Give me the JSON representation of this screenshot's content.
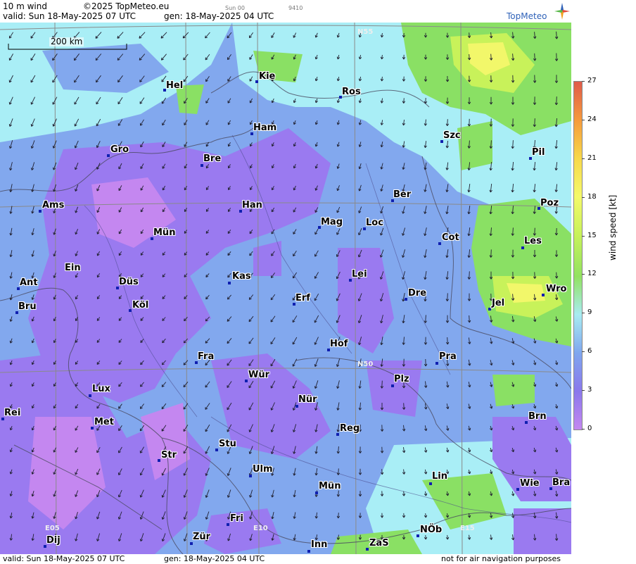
{
  "header": {
    "product": "10 m wind",
    "copyright": "©2025 TopMeteo.eu",
    "valid": "valid:  Sun  18-May-2025  07 UTC",
    "gen": "gen: 18-May-2025 04 UTC",
    "small_run": "Sun 00",
    "small_code": "9410",
    "logo_text": "TopMeteo"
  },
  "scale_bar": {
    "label": "200 km"
  },
  "grid_labels": [
    "N55",
    "N50",
    "E05",
    "E10",
    "E15"
  ],
  "cities": [
    {
      "name": "Kie"
    },
    {
      "name": "Hel"
    },
    {
      "name": "Ros"
    },
    {
      "name": "Ham"
    },
    {
      "name": "Szc"
    },
    {
      "name": "Gro"
    },
    {
      "name": "Bre"
    },
    {
      "name": "Pil"
    },
    {
      "name": "Ber"
    },
    {
      "name": "Ams"
    },
    {
      "name": "Han"
    },
    {
      "name": "Poz"
    },
    {
      "name": "Mag"
    },
    {
      "name": "Loc"
    },
    {
      "name": "Mün"
    },
    {
      "name": "Cot"
    },
    {
      "name": "Les"
    },
    {
      "name": "Ein"
    },
    {
      "name": "Kas"
    },
    {
      "name": "Lei"
    },
    {
      "name": "Ant"
    },
    {
      "name": "Düs"
    },
    {
      "name": "Wro"
    },
    {
      "name": "Dre"
    },
    {
      "name": "Erf"
    },
    {
      "name": "Bru"
    },
    {
      "name": "Köl"
    },
    {
      "name": "Jel"
    },
    {
      "name": "Hof"
    },
    {
      "name": "Fra"
    },
    {
      "name": "Pra"
    },
    {
      "name": "Wür"
    },
    {
      "name": "Plz"
    },
    {
      "name": "Lux"
    },
    {
      "name": "Nür"
    },
    {
      "name": "Rei"
    },
    {
      "name": "Met"
    },
    {
      "name": "Brn"
    },
    {
      "name": "Reg"
    },
    {
      "name": "Stu"
    },
    {
      "name": "Str"
    },
    {
      "name": "Ulm"
    },
    {
      "name": "Lin"
    },
    {
      "name": "Mün"
    },
    {
      "name": "Wie"
    },
    {
      "name": "Bra"
    },
    {
      "name": "Fri"
    },
    {
      "name": "NÖb"
    },
    {
      "name": "Dij"
    },
    {
      "name": "Zür"
    },
    {
      "name": "Inn"
    },
    {
      "name": "ZaS"
    }
  ],
  "footer": {
    "valid": "valid:  Sun  18-May-2025  07 UTC",
    "gen": "gen: 18-May-2025 04 UTC",
    "disclaimer": "not for air navigation purposes"
  },
  "legend": {
    "title": "wind speed  [kt]",
    "ticks": [
      "27",
      "24",
      "21",
      "18",
      "15",
      "12",
      "9",
      "6",
      "3",
      "0"
    ],
    "max": 27,
    "min": 0,
    "colors": [
      "#e05a4a",
      "#f59a3c",
      "#f7d84a",
      "#f5f96a",
      "#c8f25a",
      "#92e260",
      "#a8ecf2",
      "#7fa6ee",
      "#8a78ec",
      "#c487f0"
    ]
  },
  "colors": {
    "calm_purple": "#9a7af0",
    "light_blue": "#82a8ee",
    "cyan": "#a9eef6",
    "green": "#8ae064",
    "yellow": "#f2f76a",
    "grid": "#8a8a8a",
    "city_dot": "#1020b0"
  }
}
